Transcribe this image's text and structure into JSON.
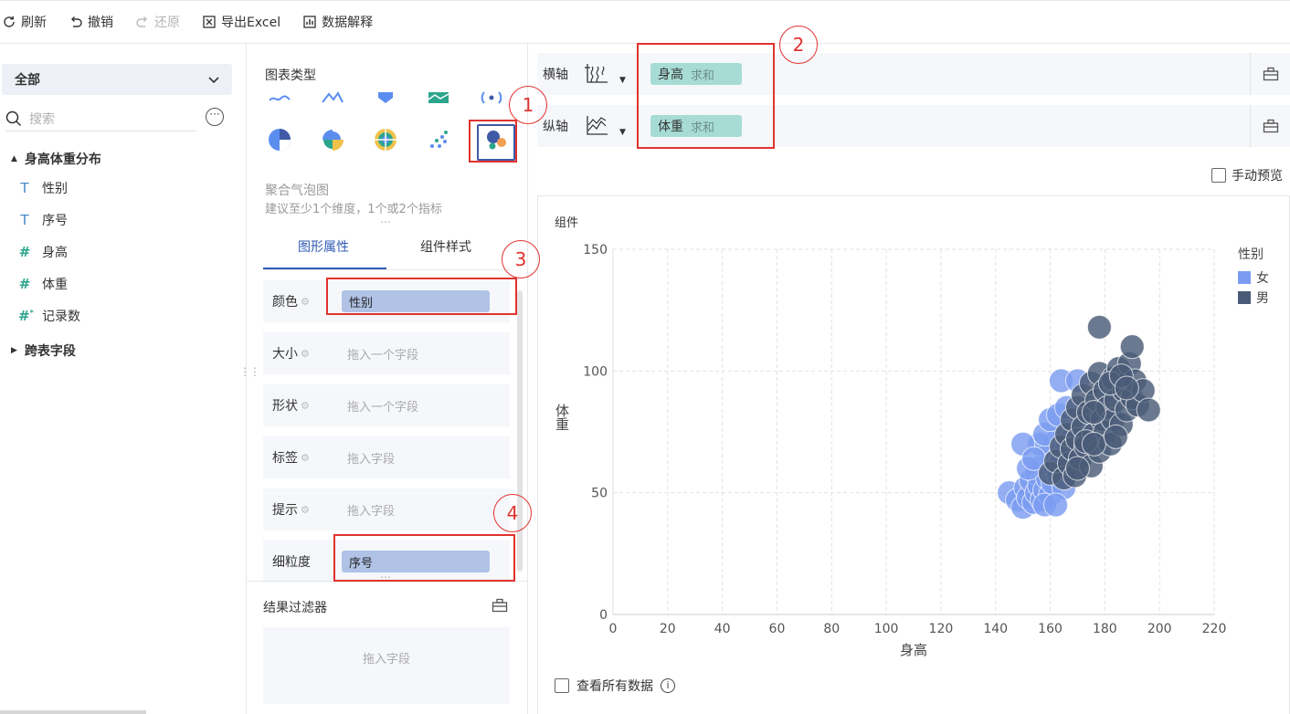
{
  "toolbar": {
    "refresh": "刷新",
    "undo": "撤销",
    "redo": "还原",
    "export": "导出Excel",
    "explain": "数据解释"
  },
  "left": {
    "dataset_label": "全部",
    "search_placeholder": "搜索",
    "table_name": "身高体重分布",
    "fields": [
      {
        "type": "T",
        "name": "性别"
      },
      {
        "type": "T",
        "name": "序号"
      },
      {
        "type": "#",
        "name": "身高"
      },
      {
        "type": "#",
        "name": "体重"
      },
      {
        "type": "#*",
        "name": "记录数"
      }
    ],
    "cross_table": "跨表字段"
  },
  "middle": {
    "chart_type_title": "图表类型",
    "chart_name": "聚合气泡图",
    "chart_hint": "建议至少1个维度，1个或2个指标",
    "tabs": [
      "图形属性",
      "组件样式"
    ],
    "props": [
      {
        "label": "颜色",
        "value": "性别",
        "placeholder": ""
      },
      {
        "label": "大小",
        "value": "",
        "placeholder": "拖入一个字段"
      },
      {
        "label": "形状",
        "value": "",
        "placeholder": "拖入一个字段"
      },
      {
        "label": "标签",
        "value": "",
        "placeholder": "拖入字段"
      },
      {
        "label": "提示",
        "value": "",
        "placeholder": "拖入字段"
      },
      {
        "label": "细粒度",
        "value": "序号",
        "placeholder": ""
      }
    ],
    "filter_title": "结果过滤器",
    "filter_placeholder": "拖入字段"
  },
  "right": {
    "x_axis_label": "横轴",
    "y_axis_label": "纵轴",
    "x_field": "身高",
    "x_agg": "求和",
    "y_field": "体重",
    "y_agg": "求和",
    "manual_preview": "手动预览",
    "panel_title": "组件",
    "view_all": "查看所有数据"
  },
  "annotations": [
    "1",
    "2",
    "3",
    "4"
  ],
  "colors": {
    "accent": "#2f5bb5",
    "female": "#7b9cf0",
    "male": "#4a5b78",
    "annotation": "#e0332f",
    "axis_chip": "#a7dcd5",
    "field_chip": "#b0c2e6"
  },
  "chart_data": {
    "type": "scatter",
    "title": "",
    "xlabel": "身高",
    "ylabel": "体重",
    "xlim": [
      0,
      220
    ],
    "ylim": [
      0,
      150
    ],
    "xticks": [
      0,
      20,
      40,
      60,
      80,
      100,
      120,
      140,
      160,
      180,
      200,
      220
    ],
    "yticks": [
      0,
      50,
      100,
      150
    ],
    "grid": true,
    "legend_title": "性别",
    "legend_position": "top-right",
    "series": [
      {
        "name": "女",
        "color": "#7b9cf0",
        "points": [
          [
            145,
            50
          ],
          [
            148,
            47
          ],
          [
            150,
            44
          ],
          [
            151,
            52
          ],
          [
            152,
            48
          ],
          [
            153,
            55
          ],
          [
            154,
            46
          ],
          [
            155,
            50
          ],
          [
            155,
            58
          ],
          [
            156,
            53
          ],
          [
            157,
            47
          ],
          [
            158,
            62
          ],
          [
            158,
            51
          ],
          [
            159,
            56
          ],
          [
            160,
            49
          ],
          [
            160,
            66
          ],
          [
            161,
            54
          ],
          [
            162,
            60
          ],
          [
            162,
            71
          ],
          [
            163,
            57
          ],
          [
            164,
            64
          ],
          [
            165,
            52
          ],
          [
            165,
            75
          ],
          [
            166,
            68
          ],
          [
            167,
            59
          ],
          [
            168,
            73
          ],
          [
            169,
            63
          ],
          [
            170,
            78
          ],
          [
            152,
            60
          ],
          [
            156,
            70
          ],
          [
            158,
            74
          ],
          [
            160,
            80
          ],
          [
            163,
            82
          ],
          [
            164,
            96
          ],
          [
            166,
            85
          ],
          [
            170,
            96
          ],
          [
            150,
            70
          ],
          [
            154,
            64
          ],
          [
            158,
            45
          ],
          [
            162,
            45
          ]
        ]
      },
      {
        "name": "男",
        "color": "#4a5b78",
        "points": [
          [
            160,
            58
          ],
          [
            162,
            63
          ],
          [
            164,
            69
          ],
          [
            165,
            56
          ],
          [
            166,
            74
          ],
          [
            167,
            62
          ],
          [
            168,
            80
          ],
          [
            168,
            68
          ],
          [
            169,
            57
          ],
          [
            170,
            85
          ],
          [
            170,
            72
          ],
          [
            171,
            64
          ],
          [
            172,
            90
          ],
          [
            172,
            77
          ],
          [
            173,
            69
          ],
          [
            174,
            83
          ],
          [
            175,
            95
          ],
          [
            175,
            61
          ],
          [
            176,
            74
          ],
          [
            177,
            88
          ],
          [
            178,
            99
          ],
          [
            178,
            67
          ],
          [
            179,
            80
          ],
          [
            180,
            92
          ],
          [
            180,
            75
          ],
          [
            181,
            85
          ],
          [
            182,
            70
          ],
          [
            183,
            97
          ],
          [
            183,
            80
          ],
          [
            184,
            88
          ],
          [
            185,
            101
          ],
          [
            186,
            78
          ],
          [
            187,
            92
          ],
          [
            188,
            84
          ],
          [
            189,
            103
          ],
          [
            190,
            89
          ],
          [
            191,
            96
          ],
          [
            192,
            86
          ],
          [
            194,
            92
          ],
          [
            196,
            84
          ],
          [
            178,
            118
          ],
          [
            190,
            110
          ],
          [
            173,
            71
          ],
          [
            176,
            83
          ],
          [
            182,
            95
          ],
          [
            186,
            98
          ],
          [
            170,
            60
          ],
          [
            176,
            70
          ],
          [
            184,
            73
          ],
          [
            188,
            93
          ]
        ]
      }
    ]
  }
}
